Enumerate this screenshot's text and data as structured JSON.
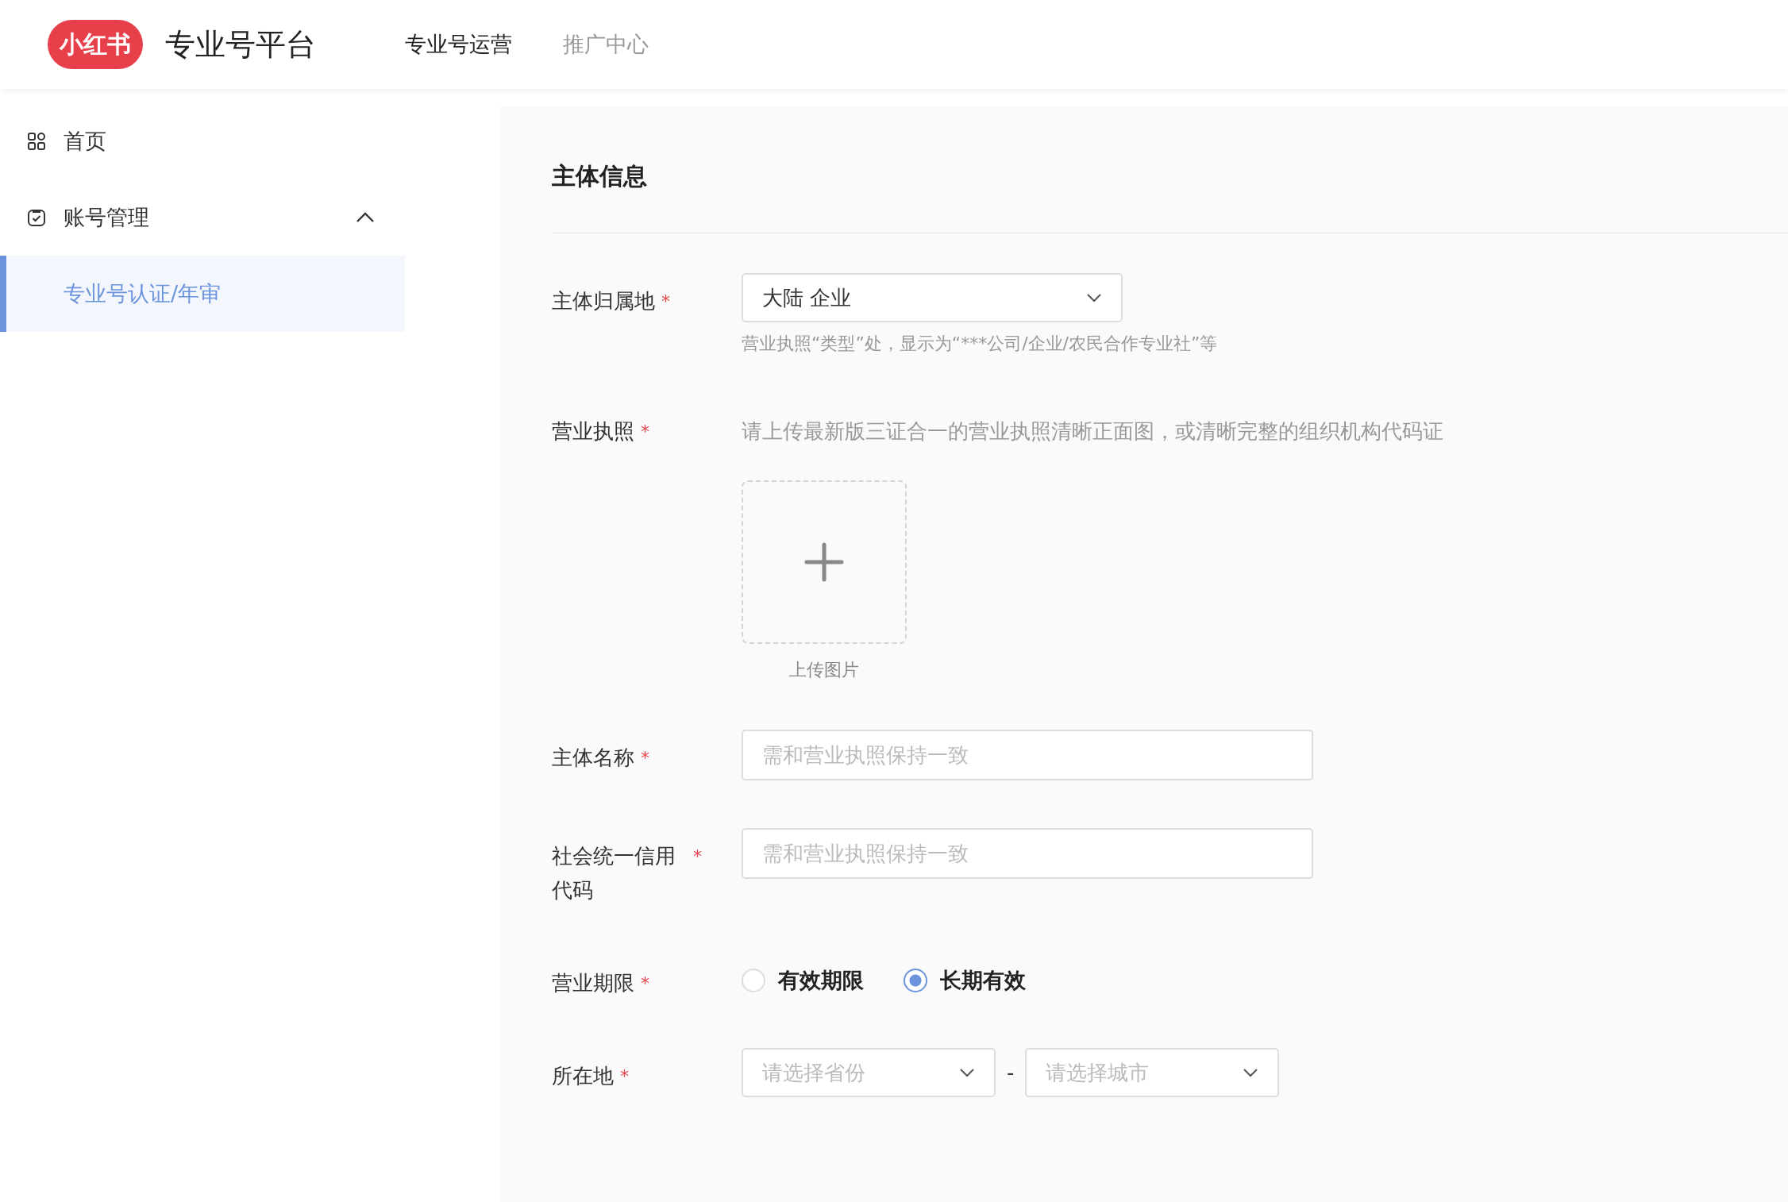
{
  "header": {
    "logo": "小红书",
    "title": "专业号平台",
    "nav": [
      {
        "label": "专业号运营",
        "selected": true
      },
      {
        "label": "推广中心",
        "selected": false
      }
    ]
  },
  "sidebar": {
    "items": [
      {
        "label": "首页",
        "selected": false
      },
      {
        "label": "账号管理",
        "selected": false,
        "expanded": true,
        "children": [
          {
            "label": "专业号认证/年审",
            "selected": true
          }
        ]
      }
    ]
  },
  "form": {
    "section_title": "主体信息",
    "fields": [
      {
        "kind": "select",
        "label": "主体归属地",
        "mark": "*",
        "value": "大陆 企业",
        "hint": "营业执照“类型”处，显示为“***公司/企业/农民合作专业社”等"
      },
      {
        "kind": "upload",
        "label": "营业执照",
        "mark": "*",
        "description": "请上传最新版三证合一的营业执照清晰正面图，或清晰完整的组织机构代码证",
        "upload_label": "上传图片"
      },
      {
        "kind": "text",
        "label": "主体名称",
        "mark": "*",
        "placeholder": "需和营业执照保持一致"
      },
      {
        "kind": "text",
        "label": "社会统一信用代码",
        "mark": "*",
        "placeholder": "需和营业执照保持一致"
      },
      {
        "kind": "radio",
        "label": "营业期限",
        "mark": "*",
        "options": [
          {
            "label": "有效期限",
            "selected": false
          },
          {
            "label": "长期有效",
            "selected": true
          }
        ]
      },
      {
        "kind": "location",
        "label": "所在地",
        "mark": "*",
        "selects": [
          {
            "placeholder": "请选择省份"
          },
          {
            "placeholder": "请选择城市"
          }
        ],
        "separator": "-"
      }
    ]
  }
}
